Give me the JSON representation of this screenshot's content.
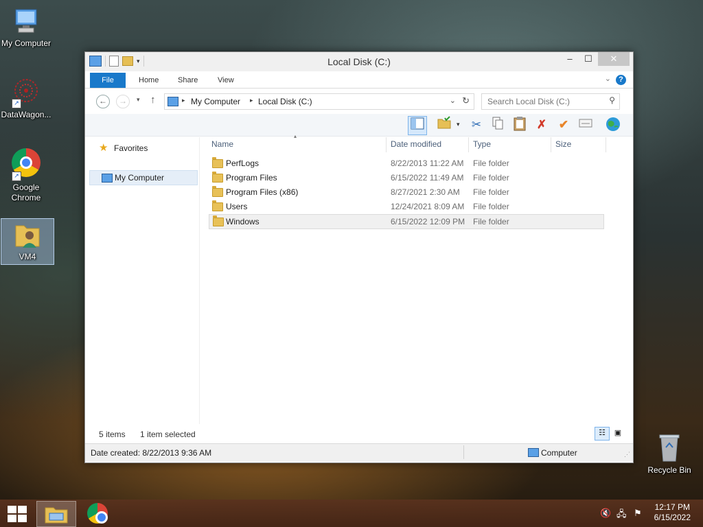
{
  "desktop": {
    "icons": [
      {
        "label": "My Computer"
      },
      {
        "label": "DataWagon..."
      },
      {
        "label": "Google Chrome"
      },
      {
        "label": "VM4"
      },
      {
        "label": "Recycle Bin"
      }
    ]
  },
  "window": {
    "title": "Local Disk (C:)",
    "controls": {
      "minimize": "–",
      "maximize": "☐",
      "close": "✕"
    },
    "ribbon": {
      "tabs": [
        "File",
        "Home",
        "Share",
        "View"
      ],
      "help": "?"
    },
    "address": {
      "crumbs": [
        "My Computer",
        "Local Disk (C:)"
      ]
    },
    "search": {
      "placeholder": "Search Local Disk (C:)"
    },
    "nav_pane": {
      "items": [
        "Favorites",
        "My Computer"
      ]
    },
    "columns": [
      "Name",
      "Date modified",
      "Type",
      "Size"
    ],
    "rows": [
      {
        "name": "PerfLogs",
        "date": "8/22/2013 11:22 AM",
        "type": "File folder",
        "size": ""
      },
      {
        "name": "Program Files",
        "date": "6/15/2022 11:49 AM",
        "type": "File folder",
        "size": ""
      },
      {
        "name": "Program Files (x86)",
        "date": "8/27/2021 2:30 AM",
        "type": "File folder",
        "size": ""
      },
      {
        "name": "Users",
        "date": "12/24/2021 8:09 AM",
        "type": "File folder",
        "size": ""
      },
      {
        "name": "Windows",
        "date": "6/15/2022 12:09 PM",
        "type": "File folder",
        "size": ""
      }
    ],
    "status": {
      "items_count": "5 items",
      "selected": "1 item selected",
      "details": "Date created: 8/22/2013 9:36 AM",
      "location": "Computer"
    }
  },
  "taskbar": {
    "time": "12:17 PM",
    "date": "6/15/2022"
  },
  "colors": {
    "accent": "#1979ca",
    "selection": "#e5eef8"
  }
}
